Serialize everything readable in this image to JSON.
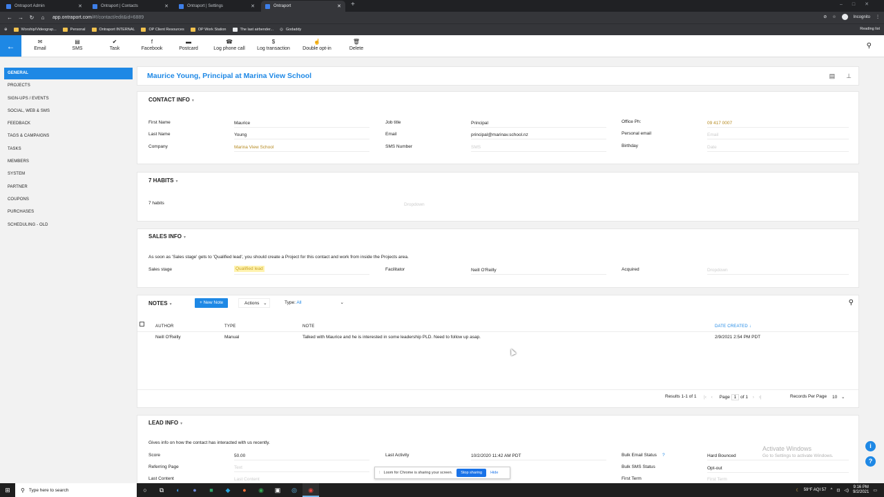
{
  "browser": {
    "tabs": [
      {
        "title": "Ontraport Admin",
        "active": false
      },
      {
        "title": "Ontraport | Contacts",
        "active": false
      },
      {
        "title": "Ontraport | Settings",
        "active": false
      },
      {
        "title": "Ontraport",
        "active": true
      }
    ],
    "new_tab": "+",
    "url_host": "app.ontraport.com",
    "url_path": "/#!/contact/edit&id=6889",
    "profile": "Incognito",
    "reading_list": "Reading list",
    "bookmarks": [
      "Worship/Videograp...",
      "Personal",
      "Ontraport INTERNAL",
      "OP Client Resources",
      "OP Work Station",
      "The last airbender...",
      "Godaddy"
    ]
  },
  "toolbar": {
    "items": [
      {
        "label": "Email",
        "icon": "✉"
      },
      {
        "label": "SMS",
        "icon": "▤"
      },
      {
        "label": "Task",
        "icon": "✔"
      },
      {
        "label": "Facebook",
        "icon": "f"
      },
      {
        "label": "Postcard",
        "icon": "▬"
      },
      {
        "label": "Log phone call",
        "icon": "☎"
      },
      {
        "label": "Log transaction",
        "icon": "$"
      },
      {
        "label": "Double opt-in",
        "icon": "☝"
      },
      {
        "label": "Delete",
        "icon": "🗑"
      }
    ]
  },
  "sidebar": {
    "items": [
      "GENERAL",
      "PROJECTS",
      "SIGN-UPS / EVENTS",
      "SOCIAL, WEB & SMS",
      "FEEDBACK",
      "TAGS & CAMPAIGNS",
      "TASKS",
      "MEMBERS",
      "SYSTEM",
      "PARTNER",
      "COUPONS",
      "PURCHASES",
      "SCHEDULING - OLD"
    ]
  },
  "contact": {
    "title": "Maurice Young, Principal at Marina View School"
  },
  "contact_info": {
    "heading": "CONTACT INFO",
    "first_name_label": "First Name",
    "first_name": "Maurice",
    "last_name_label": "Last Name",
    "last_name": "Young",
    "company_label": "Company",
    "company": "Marina View School",
    "job_title_label": "Job title",
    "job_title": "Principal",
    "email_label": "Email",
    "email": "principal@marinav.school.nz",
    "sms_label": "SMS Number",
    "sms_placeholder": "SMS",
    "office_label": "Office Ph:",
    "office": "09 417 0007",
    "personal_email_label": "Personal email",
    "personal_email_placeholder": "Email",
    "birthday_label": "Birthday",
    "birthday_placeholder": "Date"
  },
  "habits": {
    "heading": "7 HABITS",
    "label": "7 habits",
    "placeholder": "Dropdown"
  },
  "sales_info": {
    "heading": "SALES INFO",
    "note": "As soon as 'Sales stage' gets to 'Qualified lead', you should create a Project for this contact and work from inside the Projects area.",
    "stage_label": "Sales stage",
    "stage": "Qualified lead",
    "facilitator_label": "Facilitator",
    "facilitator": "Neill O'Reilly",
    "acquired_label": "Acquired",
    "acquired_placeholder": "Dropdown"
  },
  "notes": {
    "heading": "NOTES",
    "new_note": "+ New Note",
    "actions": "Actions",
    "type_label": "Type:",
    "type_value": "All",
    "columns": [
      "AUTHOR",
      "TYPE",
      "NOTE",
      "DATE CREATED ↓"
    ],
    "rows": [
      {
        "author": "Neill O'Reilly",
        "type": "Manual",
        "note": "Talked with Maurice and he is interested in some leadership PLD. Need to follow up asap.",
        "date": "2/9/2021 2:54 PM PDT"
      }
    ],
    "results": "Results 1-1 of 1",
    "page_label": "Page",
    "page": "1",
    "of": "of 1",
    "rpp_label": "Records Per Page",
    "rpp": "10"
  },
  "lead_info": {
    "heading": "LEAD INFO",
    "description": "Gives info on how the contact has interacted with us recently.",
    "score_label": "Score",
    "score": "50.00",
    "referring_label": "Referring Page",
    "referring_placeholder": "Text",
    "last_content_label": "Last Content",
    "last_content_placeholder": "Last Content",
    "last_activity_label": "Last Activity",
    "last_activity": "10/2/2020 11:42 AM PDT",
    "bulk_email_label": "Bulk Email Status",
    "bulk_email": "Hard Bounced",
    "bulk_sms_label": "Bulk SMS Status",
    "bulk_sms": "Opt-out",
    "first_term_label": "First Term",
    "first_term_placeholder": "First Term"
  },
  "windows": {
    "activate_title": "Activate Windows",
    "activate_sub": "Go to Settings to activate Windows."
  },
  "share": {
    "message": "Loom for Chrome is sharing your screen.",
    "stop": "Stop sharing",
    "hide": "Hide"
  },
  "taskbar": {
    "search": "Type here to search",
    "weather": "59°F AQI 57",
    "time": "9:16 PM",
    "date": "9/2/2021"
  }
}
